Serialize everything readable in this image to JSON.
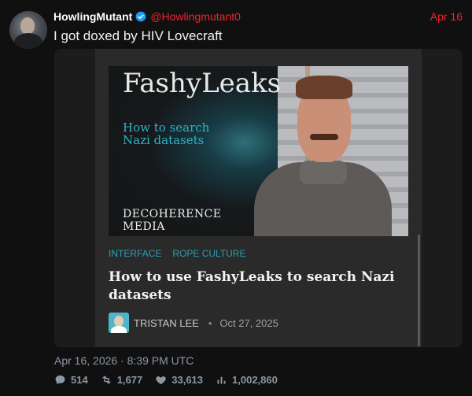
{
  "tweet": {
    "display_name": "HowlingMutant",
    "handle": "@Howlingmutant0",
    "date": "Apr 16",
    "text": "I got doxed by HIV Lovecraft",
    "timestamp": "Apr 16, 2026 · 8:39 PM UTC"
  },
  "card": {
    "thumbnail": {
      "brand": "FashyLeaks",
      "subtitle": "How to search Nazi datasets",
      "media_label_line1": "DECOHERENCE",
      "media_label_line2": "MEDIA"
    },
    "tags": [
      "INTERFACE",
      "ROPE CULTURE"
    ],
    "title": "How to use FashyLeaks to search Nazi datasets",
    "author": "TRISTAN LEE",
    "separator": "•",
    "date": "Oct 27, 2025"
  },
  "stats": {
    "replies": "514",
    "retweets": "1,677",
    "likes": "33,613",
    "views": "1,002,860"
  },
  "colors": {
    "accent_red": "#f4212e",
    "verified_blue": "#1d9bf0",
    "tag_teal": "#2a9fb4",
    "muted": "#8b98a5"
  },
  "icons": {
    "verified": "verified-badge-icon",
    "reply": "reply-icon",
    "retweet": "retweet-icon",
    "like": "heart-icon",
    "views": "views-bar-icon"
  }
}
